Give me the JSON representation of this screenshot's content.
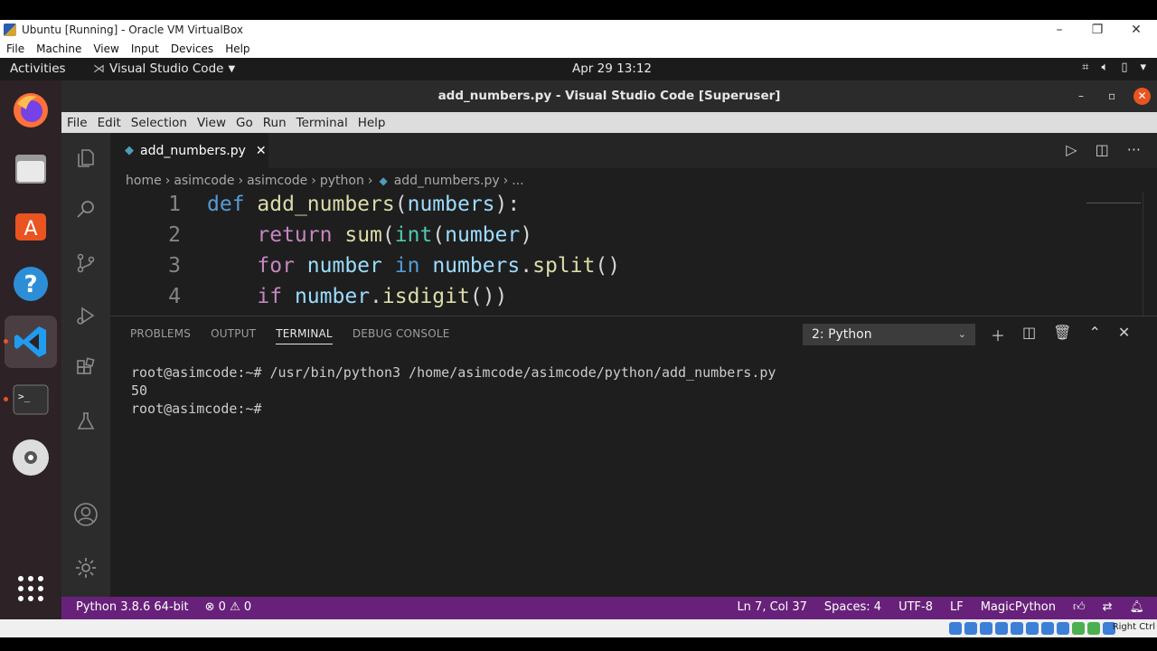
{
  "host": {
    "window_title": "Ubuntu [Running] - Oracle VM VirtualBox",
    "menu": [
      "File",
      "Machine",
      "View",
      "Input",
      "Devices",
      "Help"
    ],
    "status_key": "Right Ctrl"
  },
  "ubuntu": {
    "activities": "Activities",
    "app_name": "Visual Studio Code",
    "clock": "Apr 29  13:12"
  },
  "vscode": {
    "title": "add_numbers.py - Visual Studio Code [Superuser]",
    "menu": [
      "File",
      "Edit",
      "Selection",
      "View",
      "Go",
      "Run",
      "Terminal",
      "Help"
    ],
    "tab": {
      "label": "add_numbers.py"
    },
    "breadcrumb": [
      "home",
      "asimcode",
      "asimcode",
      "python",
      "add_numbers.py",
      "..."
    ],
    "line_numbers": [
      "1",
      "2",
      "3",
      "4"
    ],
    "panel_tabs": [
      "PROBLEMS",
      "OUTPUT",
      "TERMINAL",
      "DEBUG CONSOLE"
    ],
    "terminal_select": "2: Python",
    "terminal_lines": [
      "root@asimcode:~# /usr/bin/python3 /home/asimcode/asimcode/python/add_numbers.py",
      "50",
      "root@asimcode:~#"
    ],
    "status": {
      "interpreter": "Python 3.8.6 64-bit",
      "errors": "0",
      "warnings": "0",
      "position": "Ln 7, Col 37",
      "spaces": "Spaces: 4",
      "encoding": "UTF-8",
      "eol": "LF",
      "extension": "MagicPython"
    }
  },
  "colors": {
    "statusbar": "#68217a",
    "editor_bg": "#1e1e1e",
    "keyword": "#569cd6",
    "control_keyword": "#c586c0",
    "function": "#dcdcaa",
    "variable": "#9cdcfe"
  }
}
